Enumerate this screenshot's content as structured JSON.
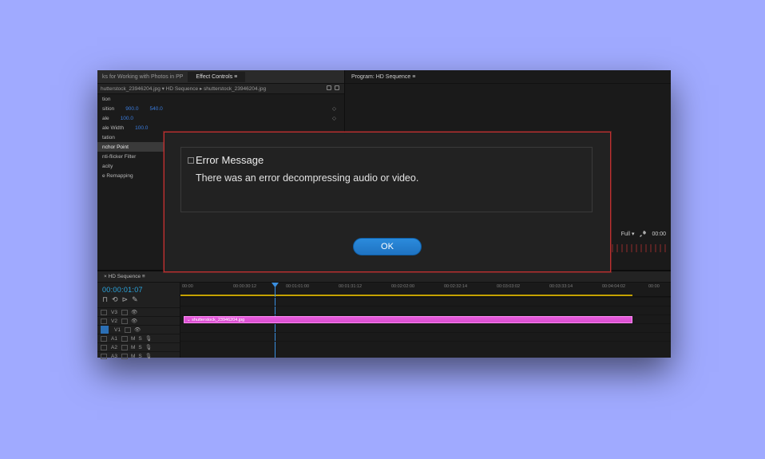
{
  "effect_panel": {
    "tabA": "ks for Working with Photos in PP",
    "tabB": "Effect Controls  ≡",
    "source_bar": "hutterstock_23946204.jpg  ▾   HD Sequence ▸ shutterstock_23946204.jpg",
    "props": [
      {
        "label": "tion",
        "vals": []
      },
      {
        "label": "sition",
        "vals": [
          "900.0",
          "540.0"
        ]
      },
      {
        "label": "ale",
        "vals": [
          "100.0"
        ]
      },
      {
        "label": "ale Width",
        "vals": [
          "100.0"
        ]
      },
      {
        "label": "tation",
        "vals": []
      },
      {
        "label": "nchor Point",
        "vals": [],
        "hl": true
      },
      {
        "label": "nti-flicker Filter",
        "vals": []
      },
      {
        "label": "acity",
        "vals": []
      },
      {
        "label": "e Remapping",
        "vals": []
      }
    ]
  },
  "program": {
    "tab": "Program: HD Sequence  ≡",
    "fit": "Full  ▾",
    "tc": "00:00"
  },
  "timeline": {
    "tab": "× HD Sequence  ≡",
    "tc": "00:00:01:07",
    "ruler": [
      "00:00",
      "00:00:30:12",
      "00:01:01:00",
      "00:01:31:12",
      "00:02:02:00",
      "00:02:32:14",
      "00:03:03:02",
      "00:03:33:14",
      "00:04:04:02",
      "00:00"
    ],
    "tracks": {
      "v": [
        "V3",
        "V2",
        "V1"
      ],
      "a": [
        "A1",
        "A2",
        "A3"
      ]
    },
    "clip": "⌄ shutterstock_23946204.jpg"
  },
  "modal": {
    "title": "Error Message",
    "body": "There was an error decompressing audio or video.",
    "ok": "OK"
  }
}
